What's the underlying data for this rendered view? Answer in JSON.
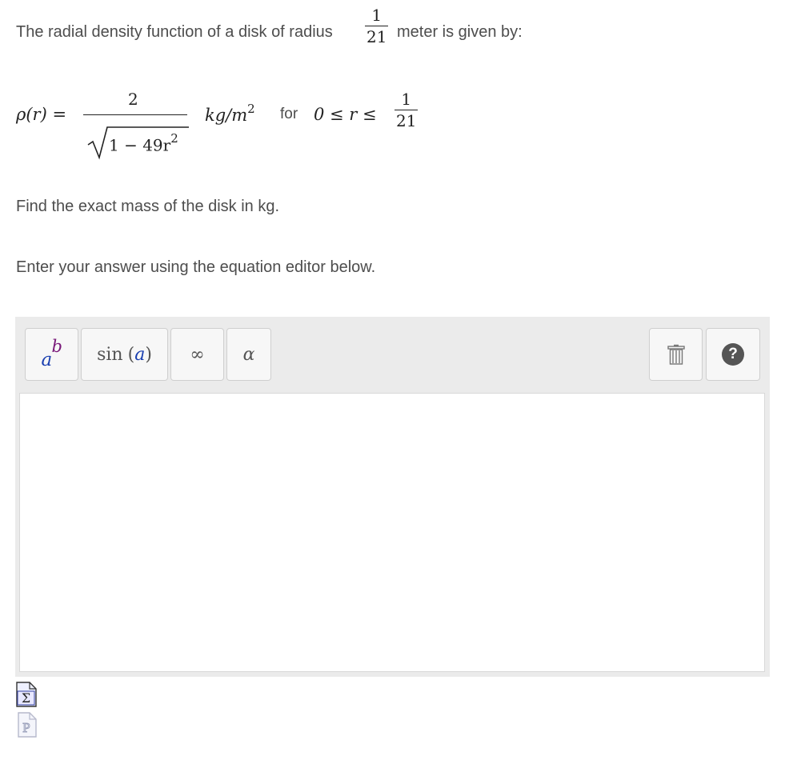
{
  "question": {
    "intro_before": "The radial density function of a disk of radius",
    "radius_num": "1",
    "radius_den": "21",
    "intro_after": "meter is given by:",
    "formula": {
      "lhs": "ρ(r) =",
      "numerator": "2",
      "radicand": "1 − 49r",
      "radicand_exp": "2",
      "units": "kg/m",
      "units_exp": "2",
      "for_label": "for",
      "range": "0 ≤ r ≤",
      "range_num": "1",
      "range_den": "21"
    },
    "find_text": "Find the exact mass of the disk in kg.",
    "instruction_text": "Enter your answer using the equation editor below."
  },
  "toolbar": {
    "power_base": "a",
    "power_exp": "b",
    "sin_label": "sin",
    "sin_arg": "a",
    "infinity_label": "∞",
    "alpha_label": "α",
    "help_label": "?"
  },
  "editor": {
    "value": ""
  },
  "icons": {
    "sigma_label": "Σ",
    "p_label": "P"
  }
}
